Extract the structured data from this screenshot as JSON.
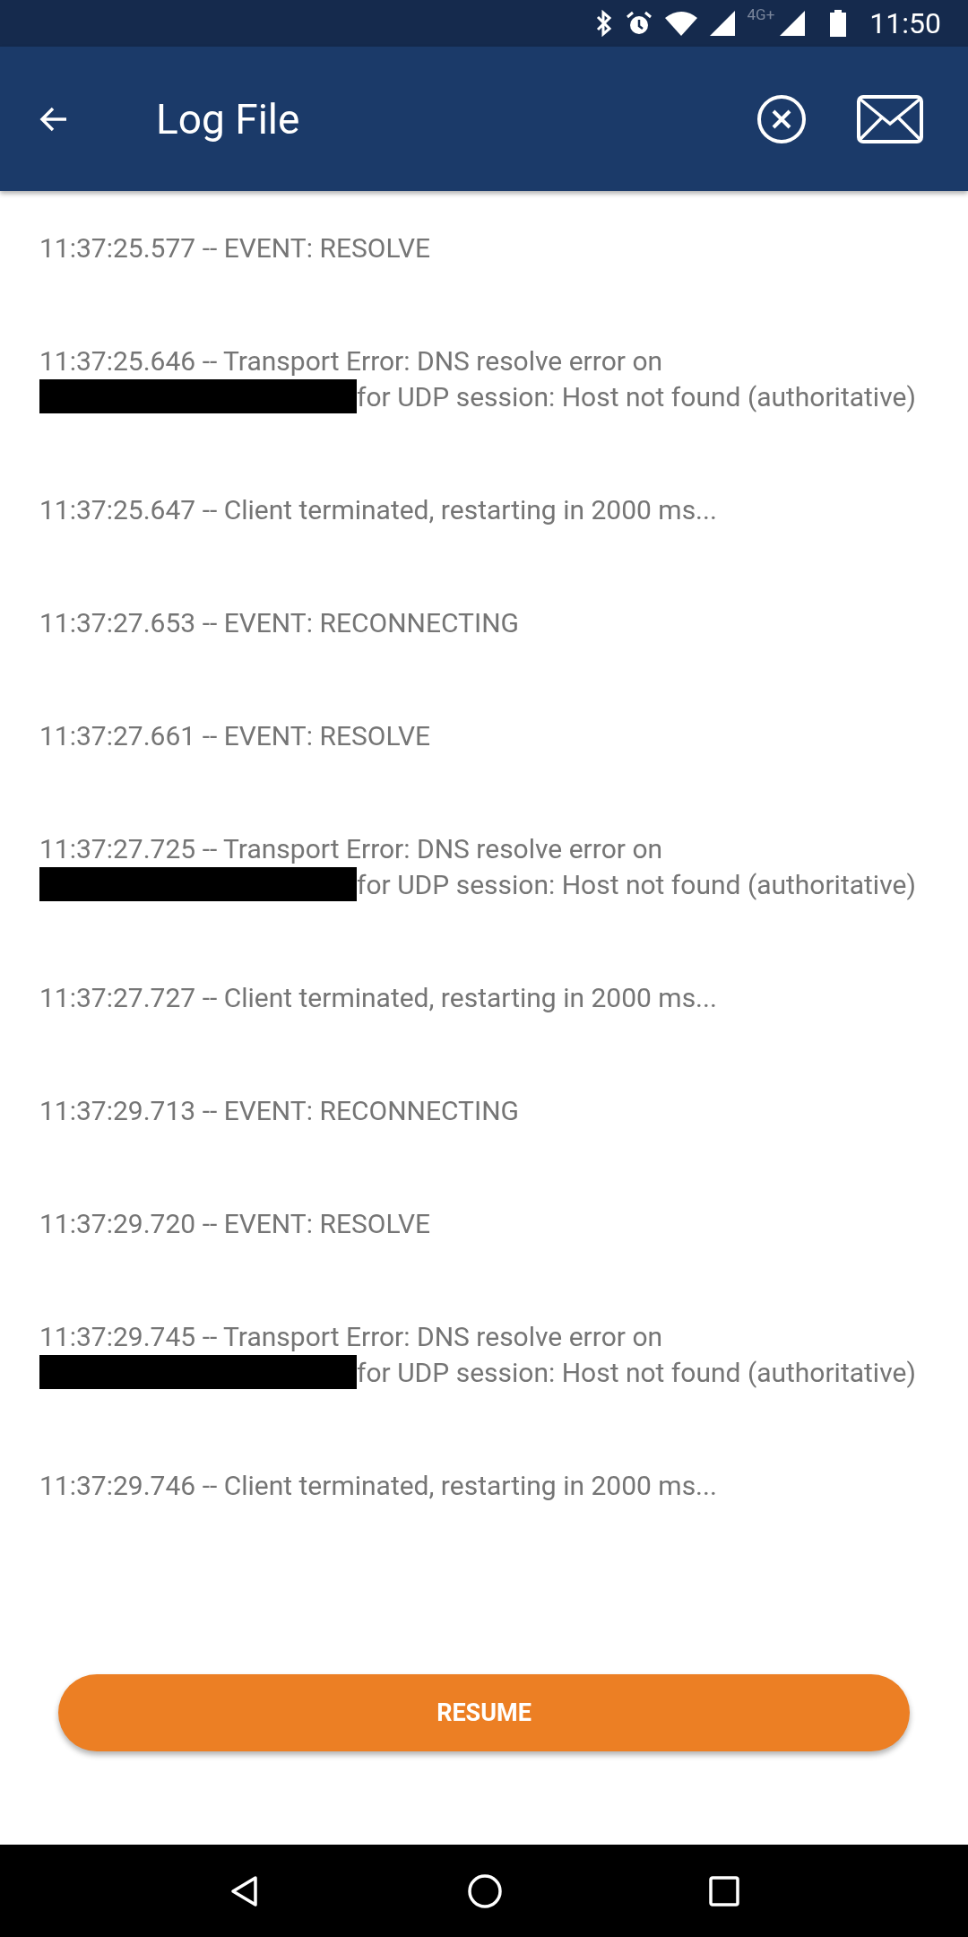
{
  "status_bar": {
    "network": "4G+",
    "time": "11:50"
  },
  "app_bar": {
    "title": "Log File"
  },
  "log_entries": [
    {
      "kind": "plain",
      "text": "11:37:25.577 -- EVENT: RESOLVE"
    },
    {
      "kind": "redacted",
      "before": "11:37:25.646 -- Transport Error: DNS resolve error on",
      "after": "for UDP session: Host not found (authoritative)"
    },
    {
      "kind": "plain",
      "text": "11:37:25.647 -- Client terminated, restarting in 2000 ms..."
    },
    {
      "kind": "plain",
      "text": "11:37:27.653 -- EVENT: RECONNECTING"
    },
    {
      "kind": "plain",
      "text": "11:37:27.661 -- EVENT: RESOLVE"
    },
    {
      "kind": "redacted",
      "before": "11:37:27.725 -- Transport Error: DNS resolve error on",
      "after": "for UDP session: Host not found (authoritative)"
    },
    {
      "kind": "plain",
      "text": "11:37:27.727 -- Client terminated, restarting in 2000 ms..."
    },
    {
      "kind": "plain",
      "text": "11:37:29.713 -- EVENT: RECONNECTING"
    },
    {
      "kind": "plain",
      "text": "11:37:29.720 -- EVENT: RESOLVE"
    },
    {
      "kind": "redacted",
      "before": "11:37:29.745 -- Transport Error: DNS resolve error on",
      "after": "for UDP session: Host not found (authoritative)"
    },
    {
      "kind": "plain",
      "text": "11:37:29.746 -- Client terminated, restarting in 2000 ms..."
    }
  ],
  "resume_button": "RESUME"
}
